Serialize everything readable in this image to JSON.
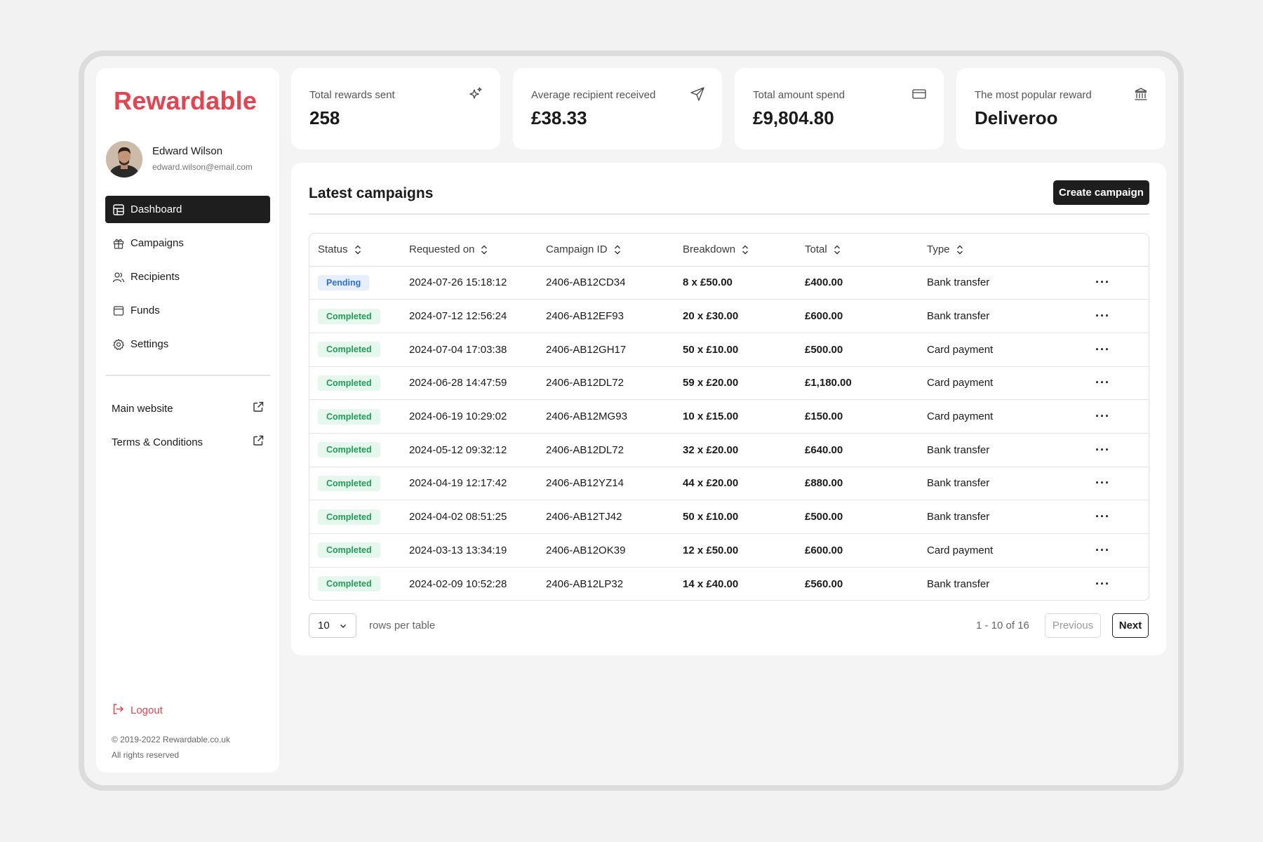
{
  "brand": {
    "name": "Rewardable",
    "accent": "#e5434f"
  },
  "user": {
    "name": "Edward Wilson",
    "email": "edward.wilson@email.com"
  },
  "nav": {
    "items": [
      {
        "label": "Dashboard",
        "icon": "dashboard-icon",
        "active": true
      },
      {
        "label": "Campaigns",
        "icon": "gift-icon",
        "active": false
      },
      {
        "label": "Recipients",
        "icon": "users-icon",
        "active": false
      },
      {
        "label": "Funds",
        "icon": "wallet-icon",
        "active": false
      },
      {
        "label": "Settings",
        "icon": "gear-icon",
        "active": false
      }
    ]
  },
  "links": {
    "main_website": "Main website",
    "terms": "Terms & Conditions"
  },
  "logout": "Logout",
  "footer": {
    "line1": "© 2019-2022 Rewardable.co.uk",
    "line2": "All rights reserved"
  },
  "stats": [
    {
      "label": "Total rewards sent",
      "value": "258",
      "icon": "sparkle-icon"
    },
    {
      "label": "Average recipient received",
      "value": "£38.33",
      "icon": "send-icon"
    },
    {
      "label": "Total amount spend",
      "value": "£9,804.80",
      "icon": "card-icon"
    },
    {
      "label": "The most popular reward",
      "value": "Deliveroo",
      "icon": "bank-icon"
    }
  ],
  "campaigns": {
    "title": "Latest campaigns",
    "create_label": "Create campaign",
    "columns": [
      "Status",
      "Requested on",
      "Campaign ID",
      "Breakdown",
      "Total",
      "Type"
    ],
    "rows": [
      {
        "status": "Pending",
        "requested": "2024-07-26 15:18:12",
        "id": "2406-AB12CD34",
        "breakdown": "8 x £50.00",
        "total": "£400.00",
        "type": "Bank transfer"
      },
      {
        "status": "Completed",
        "requested": "2024-07-12 12:56:24",
        "id": "2406-AB12EF93",
        "breakdown": "20 x £30.00",
        "total": "£600.00",
        "type": "Bank transfer"
      },
      {
        "status": "Completed",
        "requested": "2024-07-04 17:03:38",
        "id": "2406-AB12GH17",
        "breakdown": "50 x £10.00",
        "total": "£500.00",
        "type": "Card payment"
      },
      {
        "status": "Completed",
        "requested": "2024-06-28 14:47:59",
        "id": "2406-AB12DL72",
        "breakdown": "59 x £20.00",
        "total": "£1,180.00",
        "type": "Card payment"
      },
      {
        "status": "Completed",
        "requested": "2024-06-19 10:29:02",
        "id": "2406-AB12MG93",
        "breakdown": "10 x £15.00",
        "total": "£150.00",
        "type": "Card payment"
      },
      {
        "status": "Completed",
        "requested": "2024-05-12 09:32:12",
        "id": "2406-AB12DL72",
        "breakdown": "32 x £20.00",
        "total": "£640.00",
        "type": "Bank transfer"
      },
      {
        "status": "Completed",
        "requested": "2024-04-19 12:17:42",
        "id": "2406-AB12YZ14",
        "breakdown": "44 x £20.00",
        "total": "£880.00",
        "type": "Bank transfer"
      },
      {
        "status": "Completed",
        "requested": "2024-04-02 08:51:25",
        "id": "2406-AB12TJ42",
        "breakdown": "50 x £10.00",
        "total": "£500.00",
        "type": "Bank transfer"
      },
      {
        "status": "Completed",
        "requested": "2024-03-13 13:34:19",
        "id": "2406-AB12OK39",
        "breakdown": "12 x £50.00",
        "total": "£600.00",
        "type": "Card payment"
      },
      {
        "status": "Completed",
        "requested": "2024-02-09 10:52:28",
        "id": "2406-AB12LP32",
        "breakdown": "14 x £40.00",
        "total": "£560.00",
        "type": "Bank transfer"
      }
    ],
    "more_label": "···"
  },
  "pagination": {
    "rows_value": "10",
    "rows_label": "rows per table",
    "range": "1 - 10 of 16",
    "previous": "Previous",
    "next": "Next"
  }
}
